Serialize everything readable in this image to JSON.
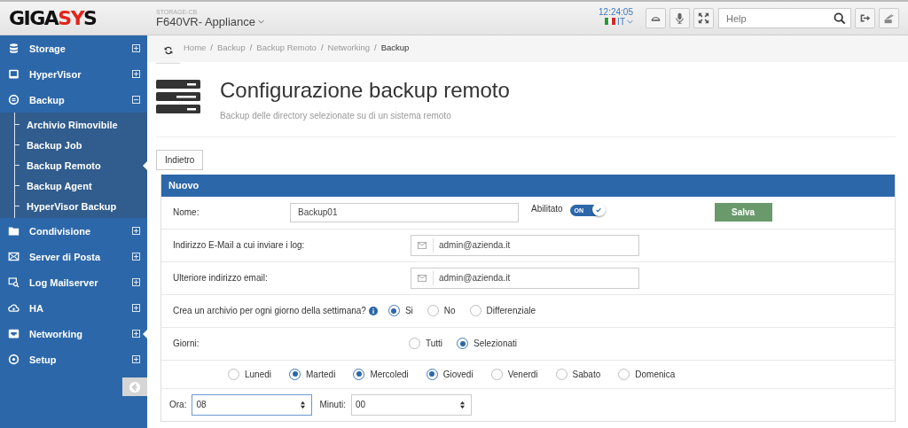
{
  "header": {
    "logo": [
      {
        "text": "GIGA",
        "accent": false
      },
      {
        "text": "SY",
        "accent": true
      },
      {
        "text": "S",
        "accent": false
      }
    ],
    "device_label": "STORAGE-CB",
    "device": "F640VR- Appliance",
    "time": "12:24:05",
    "language": "IT",
    "search": {
      "placeholder": "Help"
    }
  },
  "sidebar": {
    "items": [
      {
        "label": "Storage",
        "expanded": false,
        "selected": false
      },
      {
        "label": "HyperVisor",
        "expanded": false,
        "selected": false
      },
      {
        "label": "Backup",
        "expanded": true,
        "selected": false,
        "children": [
          {
            "label": "Archivio Rimovibile",
            "selected": false
          },
          {
            "label": "Backup Job",
            "selected": false
          },
          {
            "label": "Backup Remoto",
            "selected": true
          },
          {
            "label": "Backup Agent",
            "selected": false
          },
          {
            "label": "HyperVisor Backup",
            "selected": false
          }
        ]
      },
      {
        "label": "Condivisione",
        "expanded": false,
        "selected": false
      },
      {
        "label": "Server di Posta",
        "expanded": false,
        "selected": false
      },
      {
        "label": "Log Mailserver",
        "expanded": false,
        "selected": false
      },
      {
        "label": "HA",
        "expanded": false,
        "selected": false
      },
      {
        "label": "Networking",
        "expanded": false,
        "selected": true
      },
      {
        "label": "Setup",
        "expanded": false,
        "selected": false
      }
    ]
  },
  "breadcrumb": {
    "separator": "/",
    "items": [
      "Home",
      "Backup",
      "Backup Remoto",
      "Networking",
      "Backup"
    ]
  },
  "page": {
    "title": "Configurazione backup remoto",
    "subtitle": "Backup delle directory selezionate su di un sistema remoto",
    "back_button": "Indietro"
  },
  "panel": {
    "title": "Nuovo",
    "name": {
      "label": "Nome:",
      "value": "Backup01"
    },
    "enabled": {
      "label": "Abilitato",
      "on": true,
      "text": "ON"
    },
    "save_button": "Salva",
    "email": {
      "label": "Indirizzo E-Mail a cui inviare i log:",
      "value": "admin@azienda.it"
    },
    "email2": {
      "label": "Ulteriore indirizzo email:",
      "value": "admin@azienda.it"
    },
    "archive": {
      "label": "Crea un archivio per ogni giorno della settimana?",
      "options": [
        {
          "label": "Si",
          "selected": true
        },
        {
          "label": "No",
          "selected": false
        },
        {
          "label": "Differenziale",
          "selected": false
        }
      ]
    },
    "days": {
      "label": "Giorni:",
      "options": [
        {
          "label": "Tutti",
          "selected": false
        },
        {
          "label": "Selezionati",
          "selected": true
        }
      ]
    },
    "weekdays": [
      {
        "label": "Lunedi",
        "selected": false
      },
      {
        "label": "Martedi",
        "selected": true
      },
      {
        "label": "Mercoledi",
        "selected": true
      },
      {
        "label": "Giovedi",
        "selected": true
      },
      {
        "label": "Venerdi",
        "selected": false
      },
      {
        "label": "Sabato",
        "selected": false
      },
      {
        "label": "Domenica",
        "selected": false
      }
    ],
    "hour": {
      "label": "Ora:",
      "value": "08"
    },
    "minutes": {
      "label": "Minuti:",
      "value": "00"
    }
  }
}
